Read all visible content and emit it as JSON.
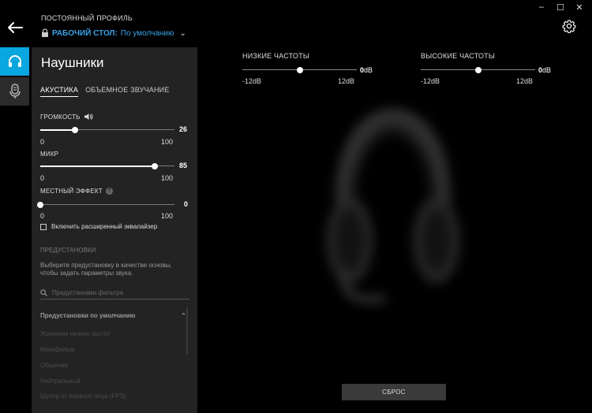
{
  "window": {
    "minimize": "–",
    "maximize": "☐",
    "close": "✕"
  },
  "header": {
    "caption": "ПОСТОЯННЫЙ ПРОФИЛЬ",
    "profile_name": "РАБОЧИЙ СТОЛ:",
    "profile_value": "По умолчанию"
  },
  "panel": {
    "title": "Наушники",
    "tabs": [
      "АКУСТИКА",
      "ОБЪЕМНОЕ ЗВУЧАНИЕ"
    ],
    "volume": {
      "label": "ГРОМКОСТЬ",
      "value": "26",
      "min": "0",
      "max": "100",
      "level": 26
    },
    "mic": {
      "label": "МИКР",
      "value": "85",
      "min": "0",
      "max": "100",
      "level": 85
    },
    "sidetone": {
      "label": "МЕСТНЫЙ ЭФФЕКТ",
      "help": "?",
      "value": "0",
      "min": "0",
      "max": "100",
      "level": 0
    },
    "advanced_eq": "Включить расширенный эквалайзер",
    "presets_heading": "ПРЕДУСТАНОВКИ",
    "presets_desc": "Выберите предустановку в качестве основы, чтобы задать параметры звука.",
    "filter_placeholder": "Предустановки фильтра",
    "group_title": "Предустановки по умолчанию",
    "presets": [
      "Усиление низких частот",
      "Кинофильм",
      "Общение",
      "Нейтральный",
      "Шутер от первого лица (FPS)"
    ]
  },
  "eq": {
    "bass": {
      "label": "НИЗКИЕ ЧАСТОТЫ",
      "value_num": "0",
      "value_unit": "dB",
      "min": "-12dB",
      "max": "12dB",
      "level": 0
    },
    "treble": {
      "label": "ВЫСОКИЕ ЧАСТОТЫ",
      "value_num": "0",
      "value_unit": "dB",
      "min": "-12dB",
      "max": "12dB",
      "level": 0
    }
  },
  "reset_label": "СБРОС",
  "colors": {
    "accent": "#0aa6df",
    "link": "#3aa3e8",
    "panel": "#232323"
  }
}
